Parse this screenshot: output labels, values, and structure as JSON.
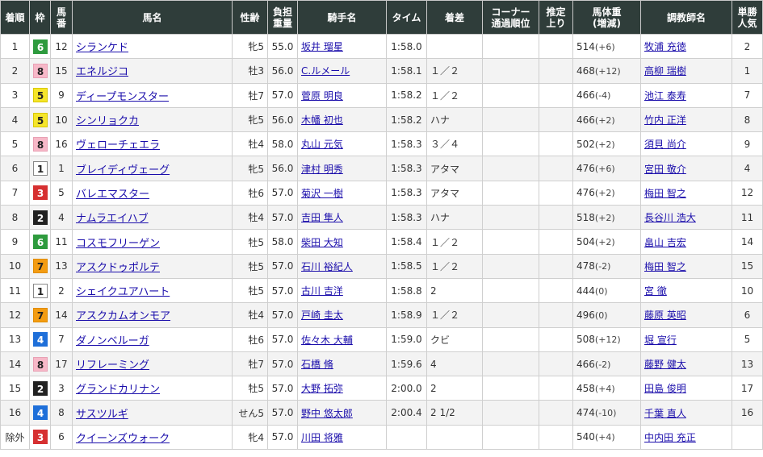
{
  "headers": {
    "rank": "着順",
    "frame": "枠",
    "num_1": "馬",
    "num_2": "番",
    "horse": "馬名",
    "sexage": "性齢",
    "load_1": "負担",
    "load_2": "重量",
    "jockey": "騎手名",
    "time": "タイム",
    "margin": "着差",
    "corner_1": "コーナー",
    "corner_2": "通過順位",
    "last_1": "推定",
    "last_2": "上り",
    "bodyw_1": "馬体重",
    "bodyw_2": "(増減)",
    "trainer": "調教師名",
    "pop_1": "単勝",
    "pop_2": "人気"
  },
  "frame_colors": {
    "1": {
      "bg": "#ffffff",
      "fg": "#222222",
      "border": "#888888"
    },
    "2": {
      "bg": "#222222",
      "fg": "#ffffff",
      "border": "#222222"
    },
    "3": {
      "bg": "#d63031",
      "fg": "#ffffff",
      "border": "#d63031"
    },
    "4": {
      "bg": "#1e6fd9",
      "fg": "#ffffff",
      "border": "#1e6fd9"
    },
    "5": {
      "bg": "#f5e52a",
      "fg": "#222222",
      "border": "#d8c800"
    },
    "6": {
      "bg": "#2e9b3e",
      "fg": "#ffffff",
      "border": "#2e9b3e"
    },
    "7": {
      "bg": "#f39c12",
      "fg": "#222222",
      "border": "#e08c00"
    },
    "8": {
      "bg": "#f7b8c8",
      "fg": "#222222",
      "border": "#e8a0b4"
    }
  },
  "rows": [
    {
      "rank": "1",
      "frame": "6",
      "num": "12",
      "horse": "シランケド",
      "sexage": "牝5",
      "load": "55.0",
      "jockey": "坂井 瑠星",
      "time": "1:58.0",
      "margin": "",
      "corner": "",
      "last": "",
      "bw": "514",
      "bwd": "(+6)",
      "trainer": "牧浦 充徳",
      "pop": "2"
    },
    {
      "rank": "2",
      "frame": "8",
      "num": "15",
      "horse": "エネルジコ",
      "sexage": "牡3",
      "load": "56.0",
      "jockey": "C.ルメール",
      "time": "1:58.1",
      "margin": "１／２",
      "corner": "",
      "last": "",
      "bw": "468",
      "bwd": "(+12)",
      "trainer": "高柳 瑞樹",
      "pop": "1"
    },
    {
      "rank": "3",
      "frame": "5",
      "num": "9",
      "horse": "ディープモンスター",
      "sexage": "牡7",
      "load": "57.0",
      "jockey": "菅原 明良",
      "time": "1:58.2",
      "margin": "１／２",
      "corner": "",
      "last": "",
      "bw": "466",
      "bwd": "(-4)",
      "trainer": "池江 泰寿",
      "pop": "7"
    },
    {
      "rank": "4",
      "frame": "5",
      "num": "10",
      "horse": "シンリョクカ",
      "sexage": "牝5",
      "load": "56.0",
      "jockey": "木幡 初也",
      "time": "1:58.2",
      "margin": "ハナ",
      "corner": "",
      "last": "",
      "bw": "466",
      "bwd": "(+2)",
      "trainer": "竹内 正洋",
      "pop": "8"
    },
    {
      "rank": "5",
      "frame": "8",
      "num": "16",
      "horse": "ヴェローチェエラ",
      "sexage": "牡4",
      "load": "58.0",
      "jockey": "丸山 元気",
      "time": "1:58.3",
      "margin": "３／４",
      "corner": "",
      "last": "",
      "bw": "502",
      "bwd": "(+2)",
      "trainer": "須貝 尚介",
      "pop": "9"
    },
    {
      "rank": "6",
      "frame": "1",
      "num": "1",
      "horse": "ブレイディヴェーグ",
      "sexage": "牝5",
      "load": "56.0",
      "jockey": "津村 明秀",
      "time": "1:58.3",
      "margin": "アタマ",
      "corner": "",
      "last": "",
      "bw": "476",
      "bwd": "(+6)",
      "trainer": "宮田 敬介",
      "pop": "4"
    },
    {
      "rank": "7",
      "frame": "3",
      "num": "5",
      "horse": "バレエマスター",
      "sexage": "牡6",
      "load": "57.0",
      "jockey": "菊沢 一樹",
      "time": "1:58.3",
      "margin": "アタマ",
      "corner": "",
      "last": "",
      "bw": "476",
      "bwd": "(+2)",
      "trainer": "梅田 智之",
      "pop": "12"
    },
    {
      "rank": "8",
      "frame": "2",
      "num": "4",
      "horse": "ナムラエイハブ",
      "sexage": "牡4",
      "load": "57.0",
      "jockey": "吉田 隼人",
      "time": "1:58.3",
      "margin": "ハナ",
      "corner": "",
      "last": "",
      "bw": "518",
      "bwd": "(+2)",
      "trainer": "長谷川 浩大",
      "pop": "11"
    },
    {
      "rank": "9",
      "frame": "6",
      "num": "11",
      "horse": "コスモフリーゲン",
      "sexage": "牡5",
      "load": "58.0",
      "jockey": "柴田 大知",
      "time": "1:58.4",
      "margin": "１／２",
      "corner": "",
      "last": "",
      "bw": "504",
      "bwd": "(+2)",
      "trainer": "畠山 吉宏",
      "pop": "14"
    },
    {
      "rank": "10",
      "frame": "7",
      "num": "13",
      "horse": "アスクドゥポルテ",
      "sexage": "牡5",
      "load": "57.0",
      "jockey": "石川 裕紀人",
      "time": "1:58.5",
      "margin": "１／２",
      "corner": "",
      "last": "",
      "bw": "478",
      "bwd": "(-2)",
      "trainer": "梅田 智之",
      "pop": "15"
    },
    {
      "rank": "11",
      "frame": "1",
      "num": "2",
      "horse": "シェイクユアハート",
      "sexage": "牡5",
      "load": "57.0",
      "jockey": "古川 吉洋",
      "time": "1:58.8",
      "margin": "2",
      "corner": "",
      "last": "",
      "bw": "444",
      "bwd": "(0)",
      "trainer": "宮 徹",
      "pop": "10"
    },
    {
      "rank": "12",
      "frame": "7",
      "num": "14",
      "horse": "アスクカムオンモア",
      "sexage": "牡4",
      "load": "57.0",
      "jockey": "戸崎 圭太",
      "time": "1:58.9",
      "margin": "１／２",
      "corner": "",
      "last": "",
      "bw": "496",
      "bwd": "(0)",
      "trainer": "藤原 英昭",
      "pop": "6"
    },
    {
      "rank": "13",
      "frame": "4",
      "num": "7",
      "horse": "ダノンベルーガ",
      "sexage": "牡6",
      "load": "57.0",
      "jockey": "佐々木 大輔",
      "time": "1:59.0",
      "margin": "クビ",
      "corner": "",
      "last": "",
      "bw": "508",
      "bwd": "(+12)",
      "trainer": "堀 宣行",
      "pop": "5"
    },
    {
      "rank": "14",
      "frame": "8",
      "num": "17",
      "horse": "リフレーミング",
      "sexage": "牡7",
      "load": "57.0",
      "jockey": "石橋 脩",
      "time": "1:59.6",
      "margin": "4",
      "corner": "",
      "last": "",
      "bw": "466",
      "bwd": "(-2)",
      "trainer": "藤野 健太",
      "pop": "13"
    },
    {
      "rank": "15",
      "frame": "2",
      "num": "3",
      "horse": "グランドカリナン",
      "sexage": "牡5",
      "load": "57.0",
      "jockey": "大野 拓弥",
      "time": "2:00.0",
      "margin": "2",
      "corner": "",
      "last": "",
      "bw": "458",
      "bwd": "(+4)",
      "trainer": "田島 俊明",
      "pop": "17"
    },
    {
      "rank": "16",
      "frame": "4",
      "num": "8",
      "horse": "サスツルギ",
      "sexage": "せん5",
      "load": "57.0",
      "jockey": "野中 悠太郎",
      "time": "2:00.4",
      "margin": "2 1/2",
      "corner": "",
      "last": "",
      "bw": "474",
      "bwd": "(-10)",
      "trainer": "千葉 直人",
      "pop": "16"
    },
    {
      "rank": "除外",
      "frame": "3",
      "num": "6",
      "horse": "クイーンズウォーク",
      "sexage": "牝4",
      "load": "57.0",
      "jockey": "川田 将雅",
      "time": "",
      "margin": "",
      "corner": "",
      "last": "",
      "bw": "540",
      "bwd": "(+4)",
      "trainer": "中内田 充正",
      "pop": ""
    }
  ]
}
